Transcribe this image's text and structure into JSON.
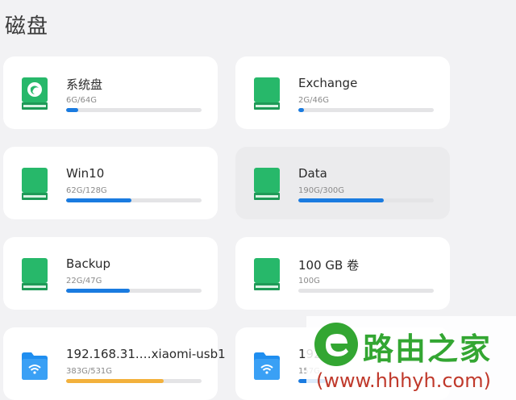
{
  "page": {
    "title": "磁盘"
  },
  "colors": {
    "normal": "#1a7be0",
    "warning": "#f3b13c",
    "drive": "#27b86a",
    "folder": "#1f8ef0"
  },
  "disks": [
    {
      "name": "系统盘",
      "usage": "6G/64G",
      "percent": 9,
      "icon": "system-drive-icon",
      "status": "normal"
    },
    {
      "name": "Exchange",
      "usage": "2G/46G",
      "percent": 4,
      "icon": "drive-icon",
      "status": "normal"
    },
    {
      "name": "Win10",
      "usage": "62G/128G",
      "percent": 48,
      "icon": "drive-icon",
      "status": "normal"
    },
    {
      "name": "Data",
      "usage": "190G/300G",
      "percent": 63,
      "icon": "drive-icon",
      "status": "normal",
      "selected": true
    },
    {
      "name": "Backup",
      "usage": "22G/47G",
      "percent": 47,
      "icon": "drive-icon",
      "status": "normal"
    },
    {
      "name": "100 GB 卷",
      "usage": "100G",
      "percent": 0,
      "icon": "drive-icon",
      "status": "normal"
    },
    {
      "name": "192.168.31.…xiaomi-usb1",
      "usage": "383G/531G",
      "percent": 72,
      "icon": "network-folder-icon",
      "status": "warning"
    },
    {
      "name": "192",
      "usage": "157G",
      "percent": 20,
      "icon": "network-folder-icon",
      "status": "normal"
    }
  ],
  "watermark": {
    "text": "路由之家",
    "url": "(www.hhhyh.com)"
  }
}
